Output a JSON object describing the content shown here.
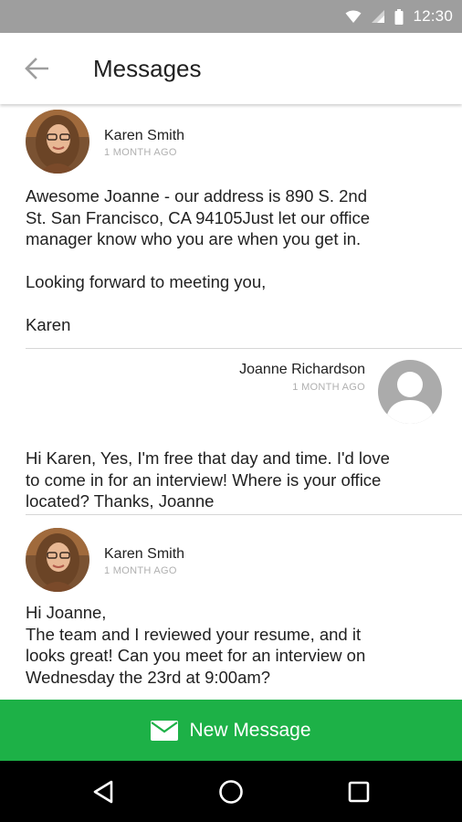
{
  "status_bar": {
    "time": "12:30"
  },
  "app_bar": {
    "title": "Messages"
  },
  "messages": [
    {
      "sender": "Karen Smith",
      "time": "1 MONTH AGO",
      "body": "Awesome Joanne - our address is 890 S. 2nd\nSt. San Francisco, CA 94105Just let our office\nmanager know who you are when you get in.\n\nLooking forward to meeting you,\n\nKaren"
    },
    {
      "sender": "Joanne Richardson",
      "time": "1 MONTH AGO",
      "body": "Hi Karen, Yes, I'm free that day and time. I'd love\nto come in for an interview! Where is your office\nlocated? Thanks, Joanne"
    },
    {
      "sender": "Karen Smith",
      "time": "1 MONTH AGO",
      "body": "Hi Joanne,\nThe team and I reviewed your resume, and it\nlooks great! Can you meet for an interview on\nWednesday the 23rd at 9:00am?"
    }
  ],
  "new_message_button": {
    "label": "New Message",
    "icon": "envelope-icon"
  },
  "nav_bar": {
    "icons": [
      "back-triangle-icon",
      "home-circle-icon",
      "recents-square-icon"
    ]
  },
  "colors": {
    "accent_green": "#1db147",
    "status_bar": "#9e9e9e",
    "divider": "#d6d6d6",
    "timestamp": "#b0b0b0"
  }
}
